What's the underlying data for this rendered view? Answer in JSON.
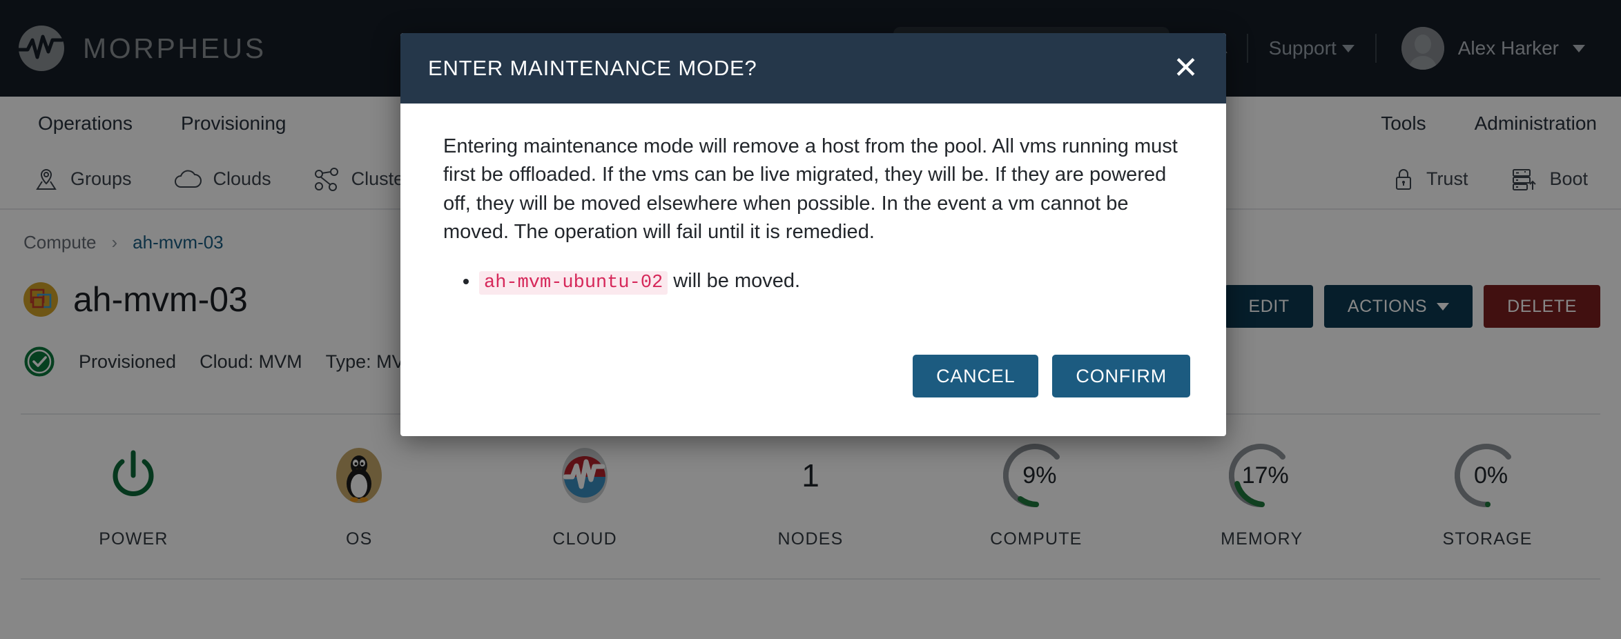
{
  "brand": {
    "name": "MORPHEUS",
    "logo_icon": "morpheus-circle-logo"
  },
  "topbar": {
    "search": {
      "value": "",
      "placeholder": "",
      "icon": "search-icon"
    },
    "bell_icon": "notification-bell-icon",
    "support_label": "Support",
    "user_name": "Alex Harker",
    "avatar_icon": "user-avatar"
  },
  "mainnav": {
    "items": [
      {
        "label": "Operations"
      },
      {
        "label": "Provisioning"
      },
      {
        "label": "Tools"
      },
      {
        "label": "Administration"
      }
    ]
  },
  "subnav": {
    "items": [
      {
        "label": "Groups",
        "icon": "map-pin-icon"
      },
      {
        "label": "Clouds",
        "icon": "cloud-icon"
      },
      {
        "label": "Clusters",
        "icon": "cluster-network-icon"
      },
      {
        "label": "Trust",
        "icon": "lock-icon"
      },
      {
        "label": "Boot",
        "icon": "server-boot-icon"
      }
    ]
  },
  "breadcrumb": {
    "root": "Compute",
    "separator": "›",
    "current": "ah-mvm-03"
  },
  "page": {
    "title": "ah-mvm-03",
    "title_icon": "host-stack-icon",
    "status": "Provisioned",
    "status_icon": "check-circle-icon",
    "meta": [
      "Cloud: MVM",
      "Type: MVM"
    ],
    "actions": [
      {
        "label": "EDIT",
        "style": "navy"
      },
      {
        "label": "ACTIONS",
        "style": "navy",
        "caret": true
      },
      {
        "label": "DELETE",
        "style": "red"
      }
    ]
  },
  "tiles": [
    {
      "label": "POWER",
      "kind": "icon",
      "icon": "power-icon",
      "value": ""
    },
    {
      "label": "OS",
      "kind": "icon",
      "icon": "linux-penguin-icon",
      "value": ""
    },
    {
      "label": "CLOUD",
      "kind": "icon",
      "icon": "morpheus-cloud-icon",
      "value": ""
    },
    {
      "label": "NODES",
      "kind": "number",
      "value": "1"
    },
    {
      "label": "COMPUTE",
      "kind": "gauge",
      "value": "9%",
      "percent": 9
    },
    {
      "label": "MEMORY",
      "kind": "gauge",
      "value": "17%",
      "percent": 17
    },
    {
      "label": "STORAGE",
      "kind": "gauge",
      "value": "0%",
      "percent": 0
    }
  ],
  "modal": {
    "title": "ENTER MAINTENANCE MODE?",
    "close_icon": "close-icon",
    "body": "Entering maintenance mode will remove a host from the pool. All vms running must first be offloaded. If the vms can be live migrated, they will be. If they are powered off, they will be moved elsewhere when possible. In the event a vm cannot be moved. The operation will fail until it is remedied.",
    "list_item_code": "ah-mvm-ubuntu-02",
    "list_item_text": " will be moved.",
    "cancel_label": "CANCEL",
    "confirm_label": "CONFIRM"
  },
  "colors": {
    "topbar_bg": "#161d26",
    "modal_header_bg": "#25374a",
    "modal_button_bg": "#1c5b80",
    "navy_button_bg": "#0d3a52",
    "red_button_bg": "#7b1f1f",
    "link": "#1a5d82",
    "gauge_fill": "#1f7a3d",
    "code_text": "#d6285a",
    "code_bg": "#fbe9ee"
  }
}
